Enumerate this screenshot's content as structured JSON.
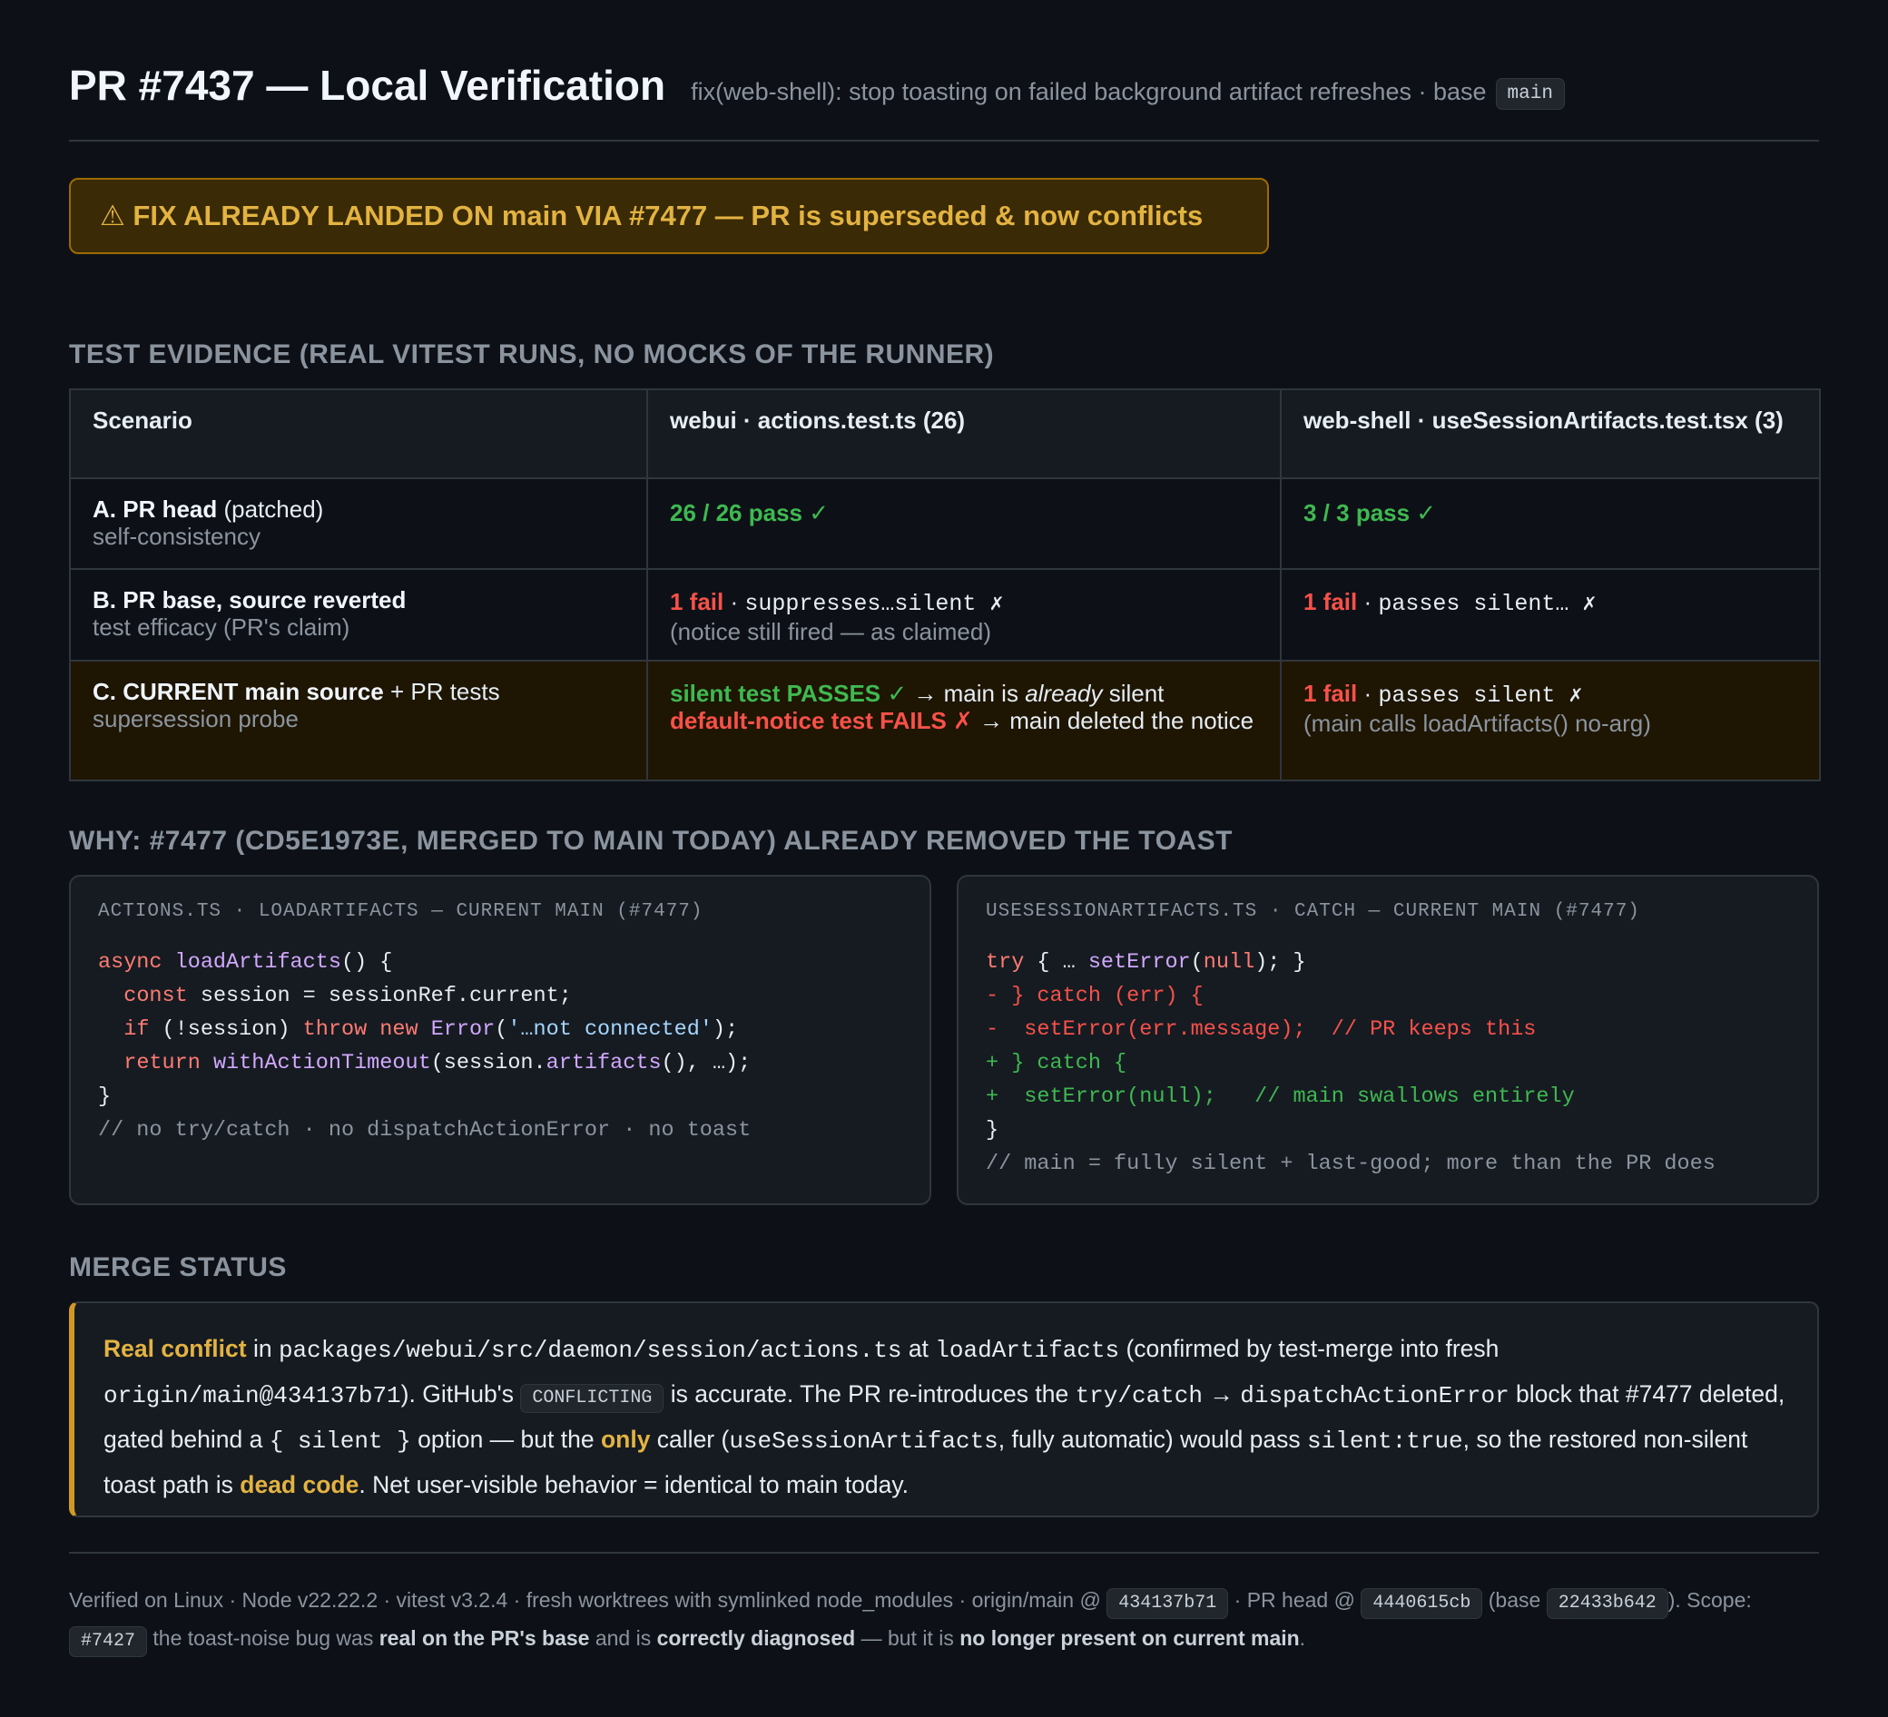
{
  "header": {
    "title": "PR #7437 — Local Verification",
    "subtitle": "fix(web-shell): stop toasting on failed background artifact refreshes · base",
    "base_branch": "main"
  },
  "warning": "⚠ FIX ALREADY LANDED ON main VIA #7477 — PR is superseded & now conflicts",
  "test_evidence": {
    "title": "Test evidence (real vitest runs, no mocks of the runner)",
    "columns": [
      "Scenario",
      "webui · actions.test.ts (26)",
      "web-shell · useSessionArtifacts.test.tsx (3)"
    ],
    "rows": [
      {
        "scenario_bold": "A. PR head",
        "scenario_rest": " (patched)",
        "scenario_sub": "self-consistency",
        "webui_result": "26 / 26 pass ✓",
        "webshell_result": "3 / 3 pass ✓"
      },
      {
        "scenario_bold": "B. PR base, source reverted",
        "scenario_sub": "test efficacy (PR's claim)",
        "webui_fail": "1 fail",
        "webui_sep": " · ",
        "webui_test": "suppresses…silent ✗",
        "webui_note": "(notice still fired — as claimed)",
        "webshell_fail": "1 fail",
        "webshell_sep": " · ",
        "webshell_test": "passes silent… ✗"
      },
      {
        "scenario_bold": "C. CURRENT main source",
        "scenario_rest": " + PR tests",
        "scenario_sub": "supersession probe",
        "webui_pass": "silent test PASSES ✓",
        "webui_pass_arrow": " → main is ",
        "webui_pass_em": "already",
        "webui_pass_rest": " silent",
        "webui_fail": "default-notice test FAILS ✗",
        "webui_fail_rest": " → main deleted the notice",
        "webshell_fail": "1 fail",
        "webshell_sep": " · ",
        "webshell_test": "passes silent ✗",
        "webshell_note": "(main calls loadArtifacts() no-arg)"
      }
    ]
  },
  "why": {
    "title": "Why: #7477 (cd5e1973e, merged to main today) already removed the toast",
    "left_panel": {
      "title": "actions.ts · loadArtifacts — current main (#7477)",
      "l1_kw": "async",
      "l1_fn": "loadArtifacts",
      "l1_rest": "() {",
      "l2_kw": "const",
      "l2_rest": " session = sessionRef.current;",
      "l3_kw": "if",
      "l3_mid": " (!session) ",
      "l3_kw2": "throw new",
      "l3_fn": "Error",
      "l3_str": "'…not connected'",
      "l3_end": ");",
      "l4_kw": "return",
      "l4_fn": "withActionTimeout",
      "l4_mid": "(session.",
      "l4_fn2": "artifacts",
      "l4_end": "(), …);",
      "l5": "}",
      "l6_comment": "// no try/catch · no dispatchActionError · no toast"
    },
    "right_panel": {
      "title": "useSessionArtifacts.ts · catch — current main (#7477)",
      "l1_kw": "try",
      "l1_mid": " { … ",
      "l1_fn": "setError",
      "l1_kw2": "null",
      "l1_end": "); }",
      "l2_del": "- } catch (err) {",
      "l3_del": "-  setError(err.message);  // PR keeps this",
      "l4_add": "+ } catch {",
      "l5_add": "+  setError(null);   // main swallows entirely",
      "l6": "}",
      "l7_comment": "// main = fully silent + last-good; more than the PR does"
    }
  },
  "merge_status": {
    "title": "Merge status",
    "p_conflict": "Real conflict",
    "p_in": " in ",
    "p_path": "packages/webui/src/daemon/session/actions.ts",
    "p_at": " at ",
    "p_fn": "loadArtifacts",
    "p_confirm": " (confirmed by test-merge into fresh ",
    "p_ref": "origin/main@434137b71",
    "p_github": "). GitHub's ",
    "p_chip": "CONFLICTING",
    "p_accurate": " is accurate. The PR re-introduces the ",
    "p_trycatch": "try/catch",
    "p_arrow": " → ",
    "p_dispatch": "dispatchActionError",
    "p_block": " block that #7477 deleted, gated behind a ",
    "p_silent_opt": "{ silent }",
    "p_option": " option — but the ",
    "p_only": "only",
    "p_caller": " caller (",
    "p_hook": "useSessionArtifacts",
    "p_auto": ", fully automatic) would pass ",
    "p_silenttrue": "silent:true",
    "p_restored": ", so the restored non-silent toast path is ",
    "p_dead": "dead code",
    "p_end": ". Net user-visible behavior = identical to main today."
  },
  "footer": {
    "f1": "Verified on Linux · Node v22.22.2 · vitest v3.2.4 · fresh worktrees with symlinked node_modules · origin/main @ ",
    "main_sha": "434137b71",
    "f2": " · PR head @ ",
    "head_sha": "4440615cb",
    "f3": " (base ",
    "base_sha": "22433b642",
    "f4": "). Scope: ",
    "scope_ref": "#7427",
    "f5": " the toast-noise bug was ",
    "b1": "real on the PR's base",
    "f6": " and is ",
    "b2": "correctly diagnosed",
    "f7": " — but it is ",
    "b3": "no longer present on current main",
    "f8": "."
  },
  "colors": {
    "background": "#0d1117",
    "pass": "#3fb950",
    "fail": "#f85149",
    "warning": "#e3b341",
    "keyword": "#ff7b72",
    "function": "#d2a8ff"
  }
}
